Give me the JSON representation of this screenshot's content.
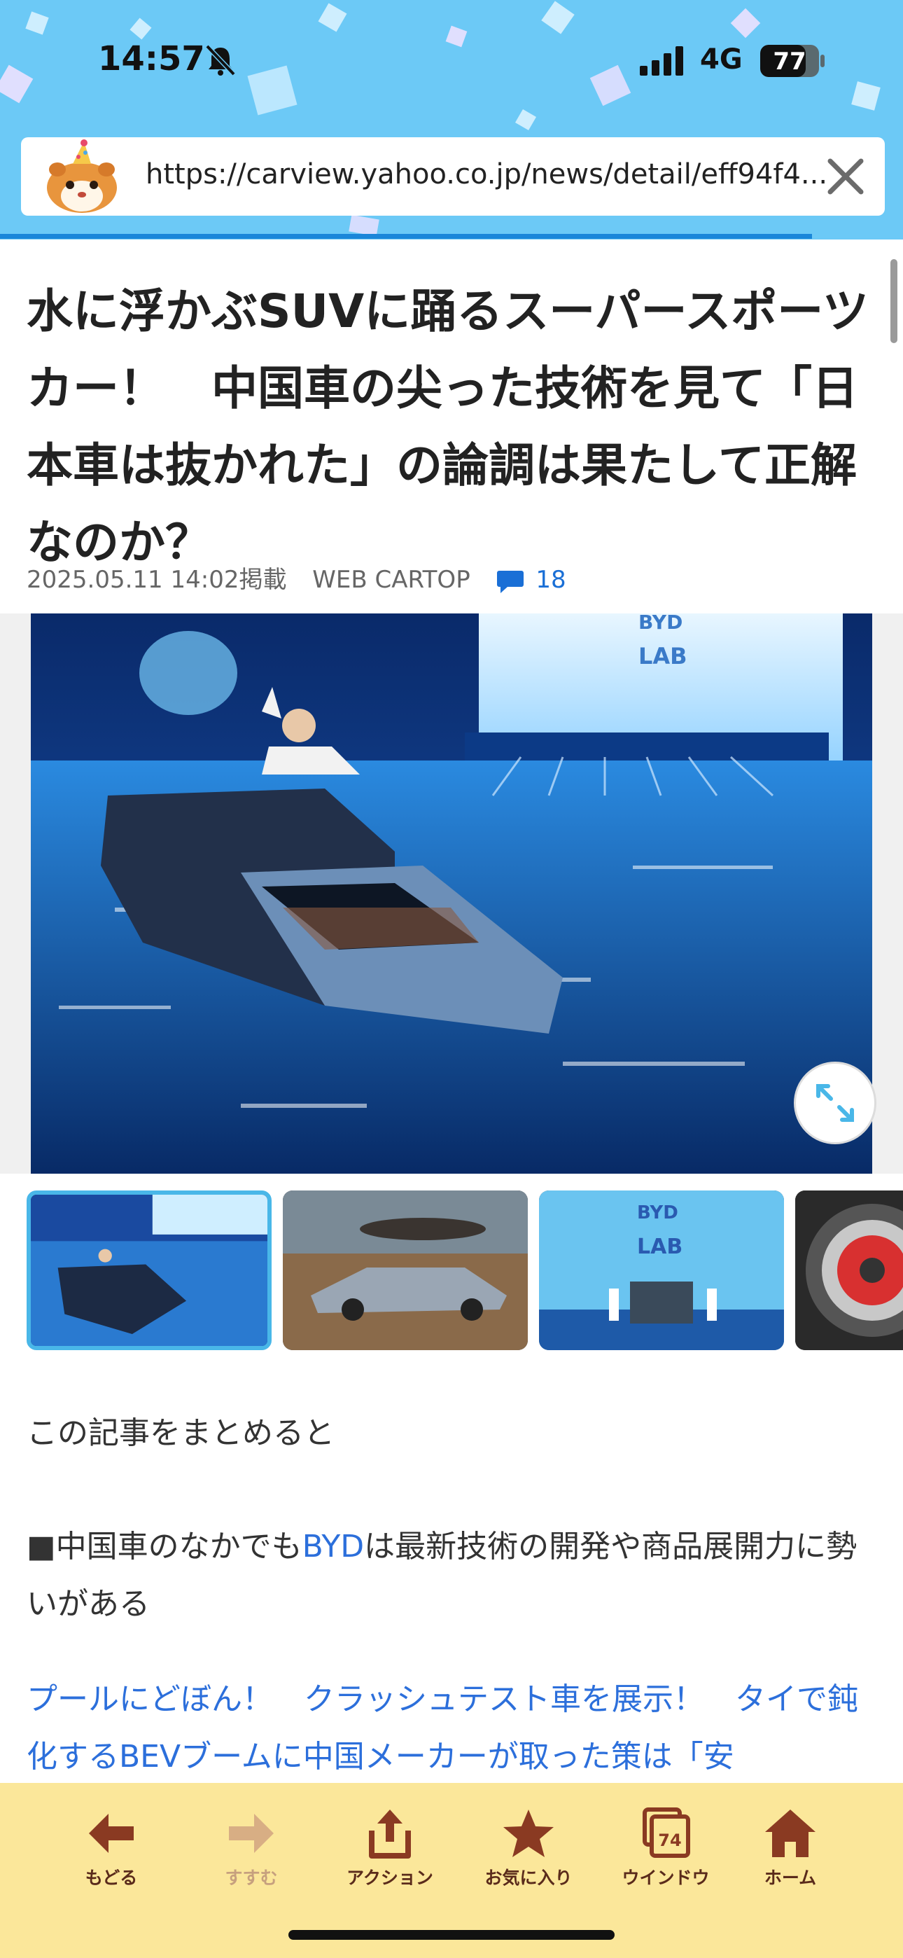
{
  "status_bar": {
    "time": "14:57",
    "network": "4G",
    "battery": "77",
    "battery_level": 0.77
  },
  "browser": {
    "url": "https://carview.yahoo.co.jp/news/detail/eff94f4..."
  },
  "article": {
    "headline": "水に浮かぶSUVに踊るスーパースポーツカー！　中国車の尖った技術を見て「日本車は抜かれた」の論調は果たして正解なのか？",
    "date": "2025.05.11 14:02掲載",
    "source": "WEB CARTOP",
    "comment_count": "18",
    "summary_heading": "この記事をまとめると",
    "bullet_prefix": "■中国車のなかでも",
    "bullet_link": "BYD",
    "bullet_suffix": "は最新技術の開発や商品展開力に勢いがある",
    "related_link": "プールにどぼん！　クラッシュテスト車を展示！　タイで鈍化するBEVブームに中国メーカーが取った策は「安",
    "hero_sign": [
      "BYD",
      "LAB"
    ]
  },
  "toolbar": {
    "back": "もどる",
    "forward": "すすむ",
    "action": "アクション",
    "favorites": "お気に入り",
    "windows": "ウインドウ",
    "windows_count": "74",
    "home": "ホーム"
  }
}
